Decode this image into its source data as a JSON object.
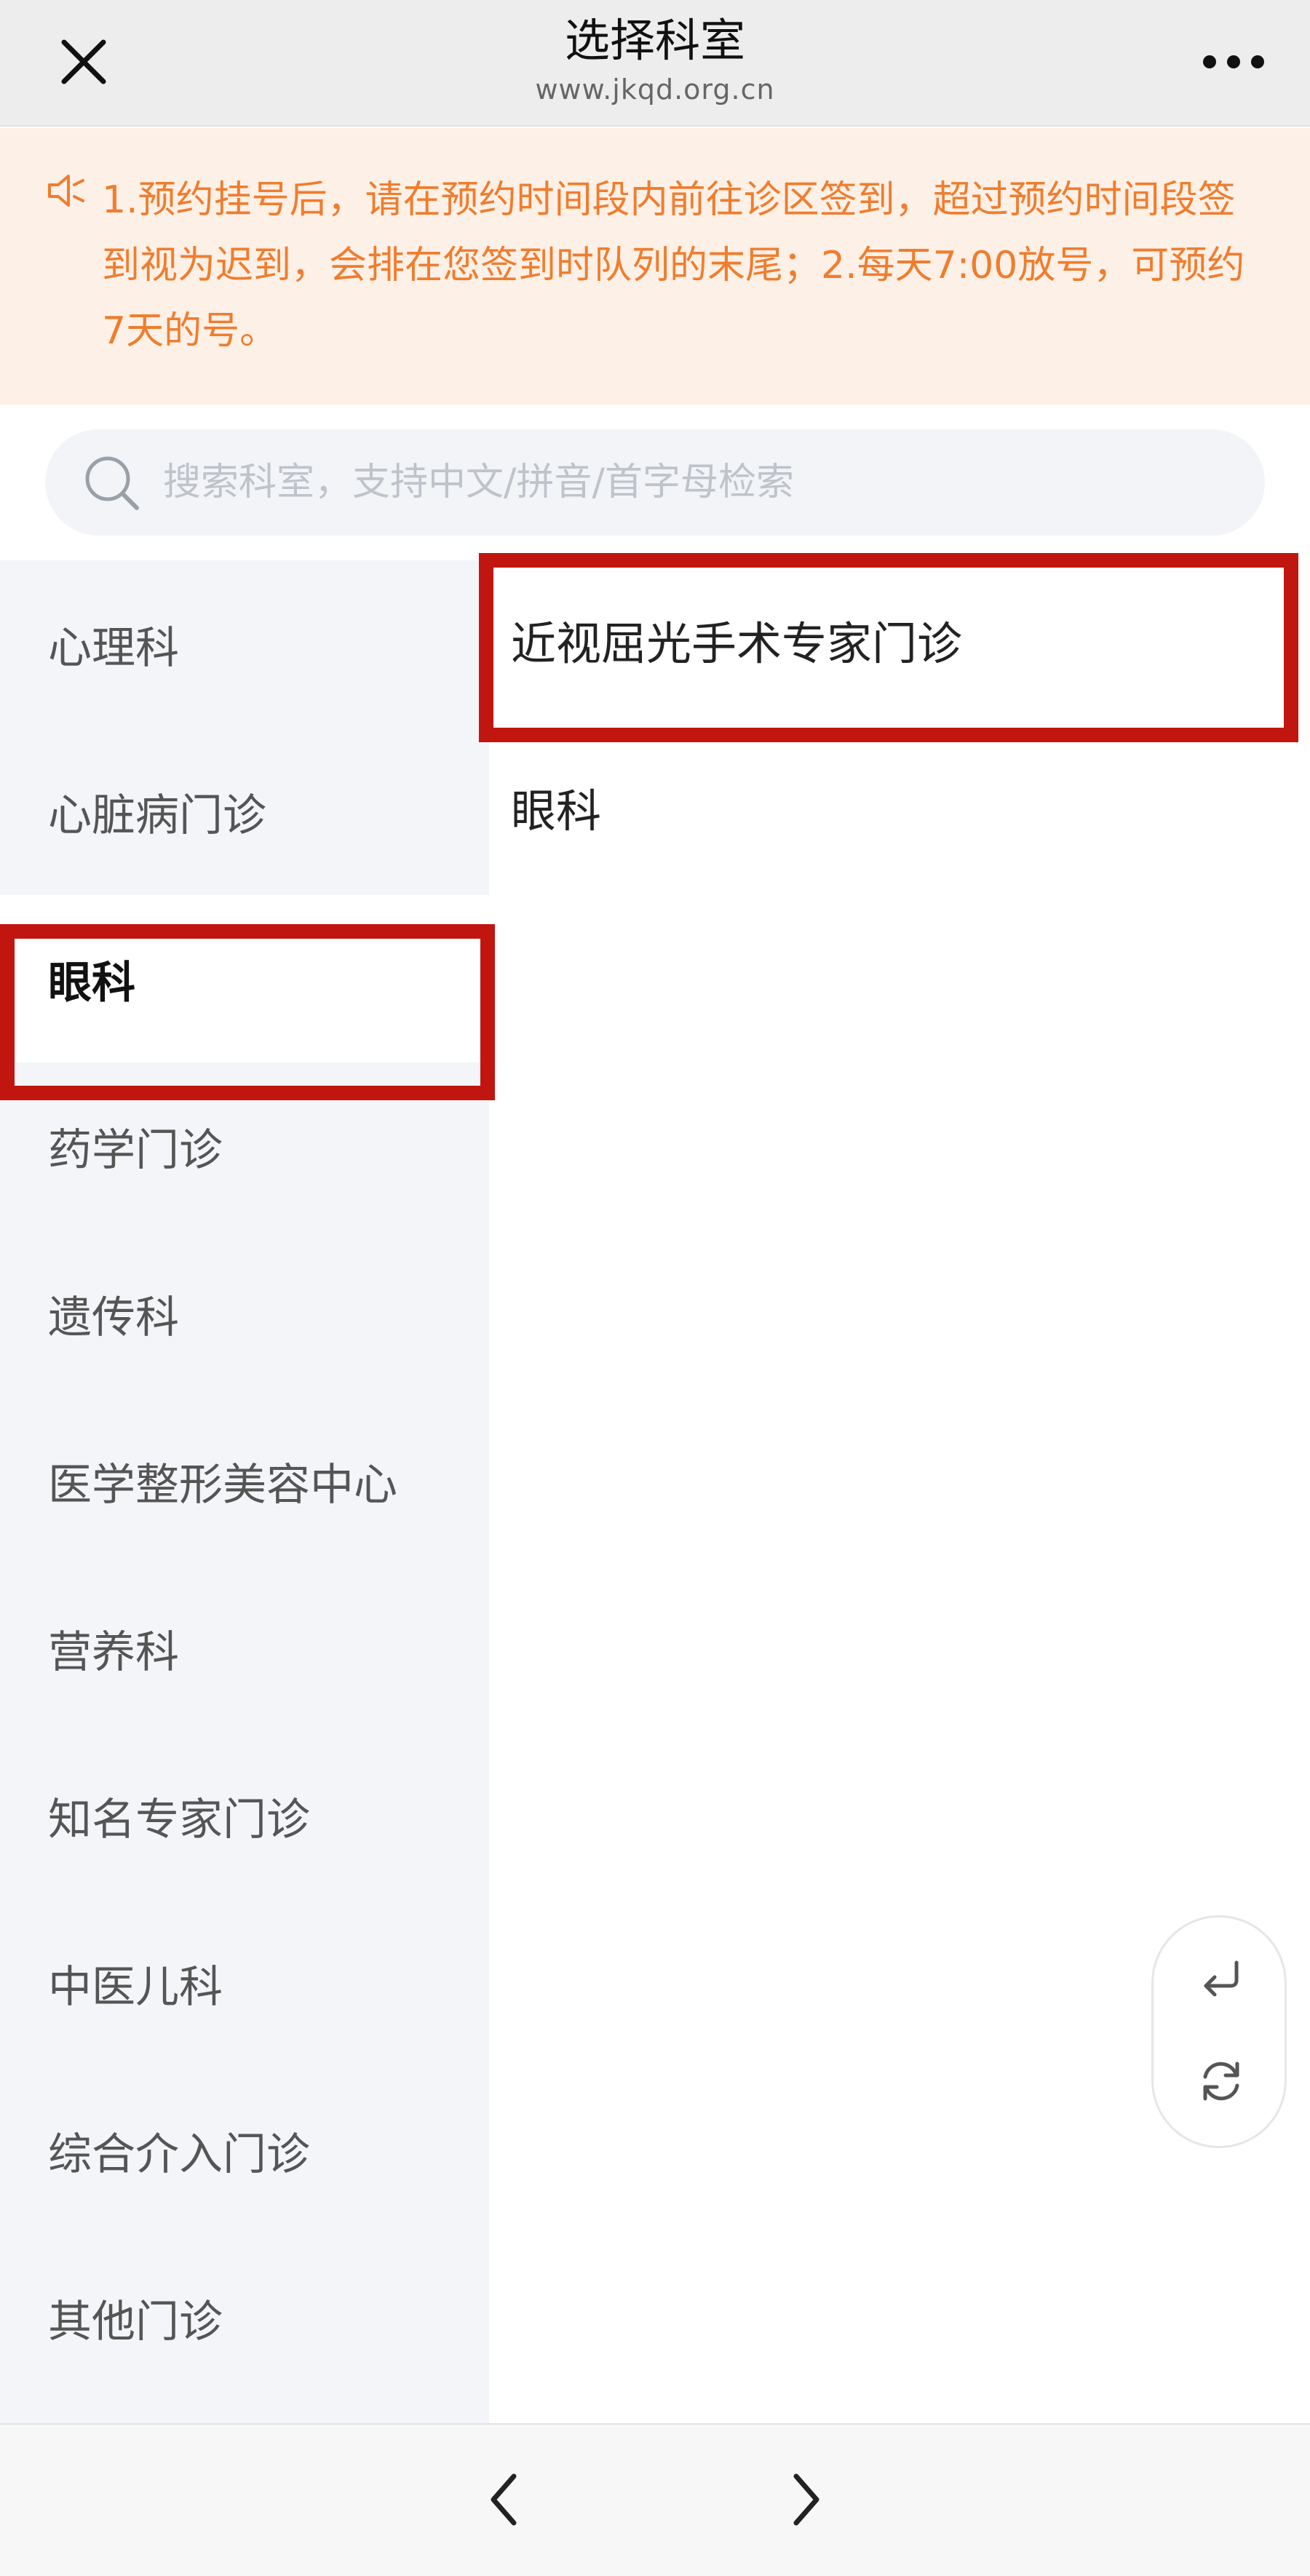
{
  "header": {
    "title": "选择科室",
    "subtitle": "www.jkqd.org.cn",
    "close_icon": "close-icon",
    "more_icon": "more-icon"
  },
  "notice": {
    "icon": "speaker-icon",
    "text": "1.预约挂号后，请在预约时间段内前往诊区签到，超过预约时间段签到视为迟到，会排在您签到时队列的末尾；2.每天7:00放号，可预约7天的号。",
    "color": "#ef7d2e",
    "background": "#fdf0e6"
  },
  "search": {
    "placeholder": "搜索科室，支持中文/拼音/首字母检索",
    "value": ""
  },
  "sidebar": {
    "items": [
      {
        "label": "心理科"
      },
      {
        "label": "心脏病门诊"
      },
      {
        "label": "眼科"
      },
      {
        "label": "药学门诊"
      },
      {
        "label": "遗传科"
      },
      {
        "label": "医学整形美容中心"
      },
      {
        "label": "营养科"
      },
      {
        "label": "知名专家门诊"
      },
      {
        "label": "中医儿科"
      },
      {
        "label": "综合介入门诊"
      },
      {
        "label": "其他门诊"
      }
    ],
    "selected": "眼科"
  },
  "departments": {
    "items": [
      {
        "label": "近视屈光手术专家门诊"
      },
      {
        "label": "眼科"
      }
    ]
  },
  "highlight_color": "#c0160f",
  "floating": {
    "back_icon": "return-arrow-icon",
    "refresh_icon": "refresh-icon"
  },
  "bottom_nav": {
    "back_icon": "chevron-left-icon",
    "forward_icon": "chevron-right-icon"
  }
}
